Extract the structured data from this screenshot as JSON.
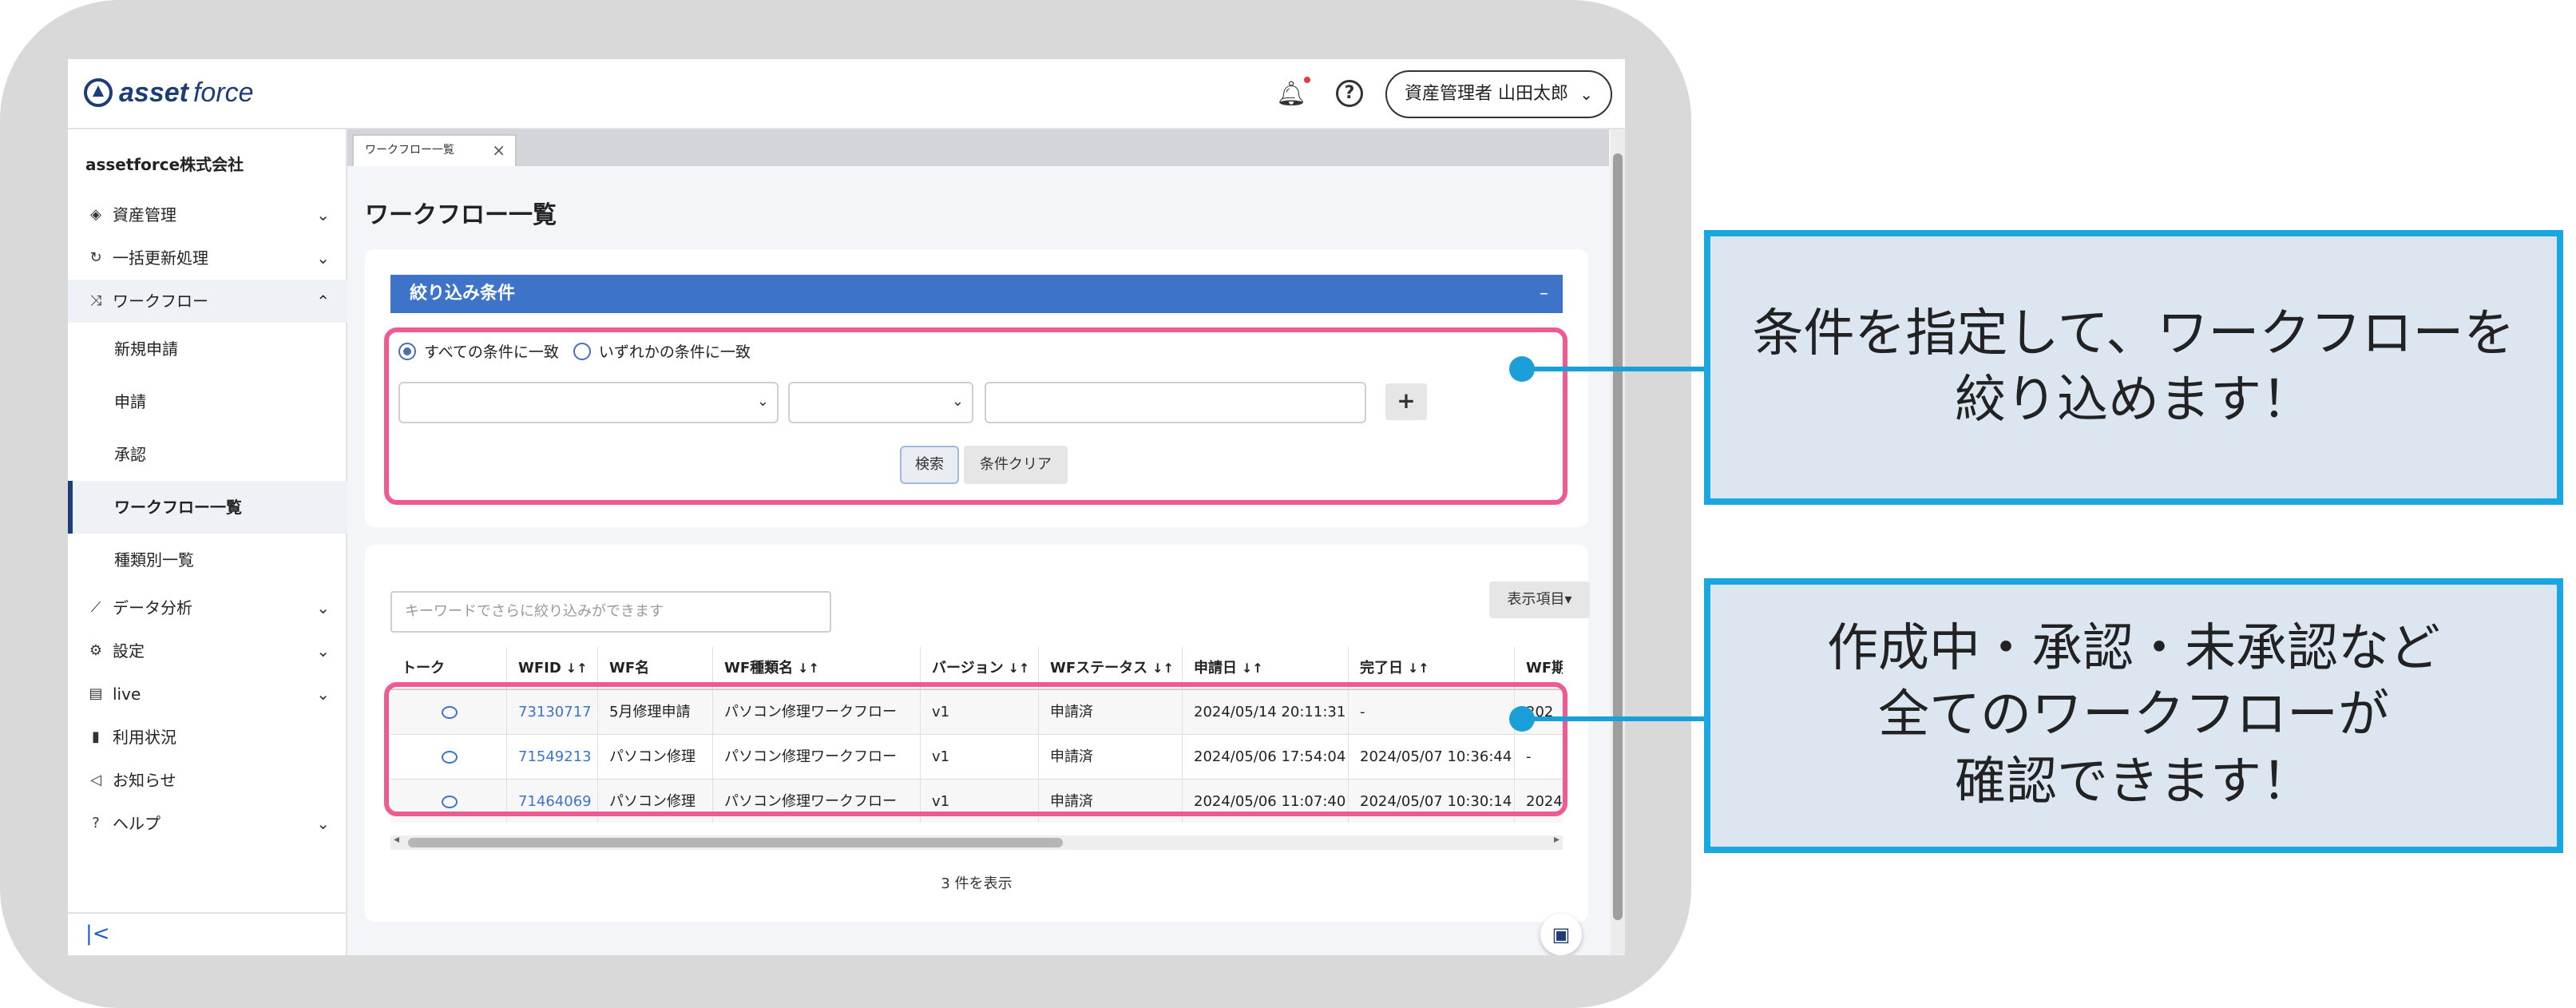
{
  "header": {
    "logo_bold": "asset",
    "logo_light": "force",
    "user_button": "資産管理者 山田太郎"
  },
  "sidebar": {
    "company": "assetforce株式会社",
    "items": [
      {
        "label": "資産管理",
        "icon": "cube-icon"
      },
      {
        "label": "一括更新処理",
        "icon": "refresh-icon"
      },
      {
        "label": "ワークフロー",
        "icon": "workflow-icon"
      },
      {
        "label": "データ分析",
        "icon": "analytics-icon"
      },
      {
        "label": "設定",
        "icon": "gear-icon"
      },
      {
        "label": "live",
        "icon": "live-icon"
      },
      {
        "label": "利用状況",
        "icon": "bar-chart-icon"
      },
      {
        "label": "お知らせ",
        "icon": "megaphone-icon"
      },
      {
        "label": "ヘルプ",
        "icon": "help-icon"
      }
    ],
    "sub_items": [
      "新規申請",
      "申請",
      "承認",
      "ワークフロー一覧",
      "種類別一覧"
    ],
    "collapse_label": "|<"
  },
  "tab": {
    "label": "ワークフロー一覧"
  },
  "page_title": "ワークフロー一覧",
  "filter": {
    "header": "絞り込み条件",
    "minimize": "–",
    "radio_all": "すべての条件に一致",
    "radio_any": "いずれかの条件に一致",
    "plus": "+",
    "search_btn": "検索",
    "clear_btn": "条件クリア"
  },
  "list": {
    "keyword_placeholder": "キーワードでさらに絞り込みができます",
    "columns_btn": "表示項目▾",
    "headers": [
      "トーク",
      "WFID",
      "WF名",
      "WF種類名",
      "バージョン",
      "WFステータス",
      "申請日",
      "完了日",
      "WF期"
    ],
    "rows": [
      [
        "",
        "73130717",
        "5月修理申請",
        "パソコン修理ワークフロー",
        "v1",
        "申請済",
        "2024/05/14 20:11:31",
        "-",
        "202"
      ],
      [
        "",
        "71549213",
        "パソコン修理",
        "パソコン修理ワークフロー",
        "v1",
        "申請済",
        "2024/05/06 17:54:04",
        "2024/05/07 10:36:44",
        "-"
      ],
      [
        "",
        "71464069",
        "パソコン修理",
        "パソコン修理ワークフロー",
        "v1",
        "申請済",
        "2024/05/06 11:07:40",
        "2024/05/07 10:30:14",
        "2024"
      ]
    ],
    "count": "3 件を表示"
  },
  "callouts": {
    "top": [
      "条件を指定して、ワークフローを",
      "絞り込めます！"
    ],
    "bottom": [
      "作成中・承認・未承認など",
      "全てのワークフローが",
      "確認できます！"
    ]
  },
  "colors": {
    "accent": "#3d73c9",
    "highlight": "#ef5a93",
    "callout_border": "#1aa6df",
    "callout_bg": "#dce6f1"
  }
}
